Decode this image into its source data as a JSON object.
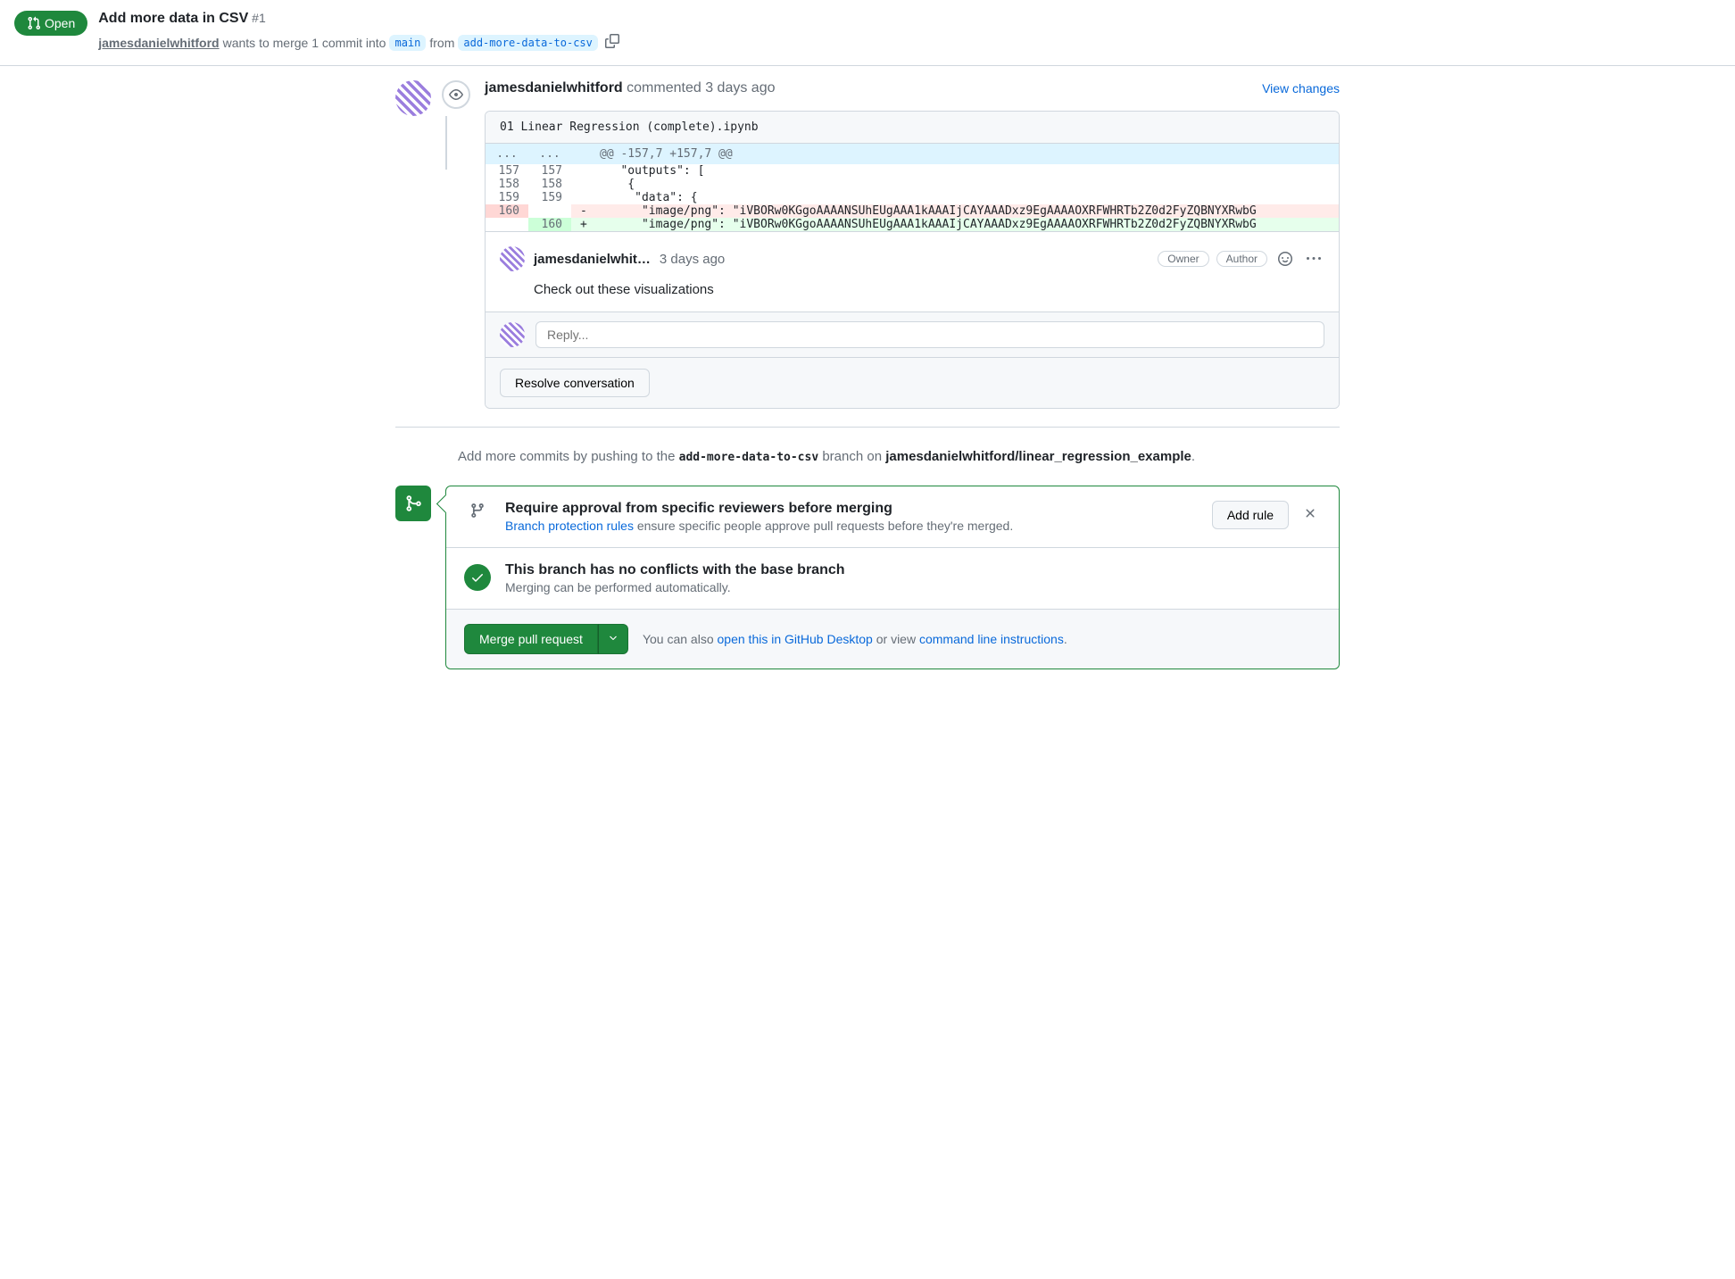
{
  "header": {
    "status": "Open",
    "title": "Add more data in CSV",
    "pr_number": "#1",
    "author": "jamesdanielwhitford",
    "merge_text_1": "wants to merge 1 commit into",
    "base_branch": "main",
    "merge_text_2": "from",
    "head_branch": "add-more-data-to-csv"
  },
  "review": {
    "author": "jamesdanielwhitford",
    "action": "commented",
    "time": "3 days ago",
    "view_changes": "View changes",
    "filename": "01 Linear Regression (complete).ipynb",
    "hunk_header": "@@ -157,7 +157,7 @@",
    "expand": "...",
    "rows": [
      {
        "old": "157",
        "new": "157",
        "sign": " ",
        "code": "   \"outputs\": ["
      },
      {
        "old": "158",
        "new": "158",
        "sign": " ",
        "code": "    {"
      },
      {
        "old": "159",
        "new": "159",
        "sign": " ",
        "code": "     \"data\": {"
      },
      {
        "old": "160",
        "new": "",
        "sign": "-",
        "code": "      \"image/png\": \"iVBORw0KGgoAAAANSUhEUgAAA1kAAAIjCAYAAADxz9EgAAAAOXRFWHRTb2Z0d2FyZQBNYXRwbG"
      },
      {
        "old": "",
        "new": "160",
        "sign": "+",
        "code": "      \"image/png\": \"iVBORw0KGgoAAAANSUhEUgAAA1kAAAIjCAYAAADxz9EgAAAAOXRFWHRTb2Z0d2FyZQBNYXRwbG"
      }
    ],
    "comment": {
      "author": "jamesdanielwhit…",
      "time": "3 days ago",
      "roles": [
        "Owner",
        "Author"
      ],
      "body": "Check out these visualizations"
    },
    "reply_placeholder": "Reply...",
    "resolve_label": "Resolve conversation"
  },
  "commit_hint": {
    "prefix": "Add more commits by pushing to the",
    "branch": "add-more-data-to-csv",
    "middle": "branch on",
    "repo": "jamesdanielwhitford/linear_regression_example",
    "suffix": "."
  },
  "merge": {
    "rule": {
      "title": "Require approval from specific reviewers before merging",
      "link": "Branch protection rules",
      "desc_rest": " ensure specific people approve pull requests before they're merged.",
      "add_rule": "Add rule"
    },
    "conflict": {
      "title": "This branch has no conflicts with the base branch",
      "desc": "Merging can be performed automatically."
    },
    "footer": {
      "button": "Merge pull request",
      "text_1": "You can also ",
      "link_1": "open this in GitHub Desktop",
      "text_2": " or view ",
      "link_2": "command line instructions",
      "text_3": "."
    }
  }
}
